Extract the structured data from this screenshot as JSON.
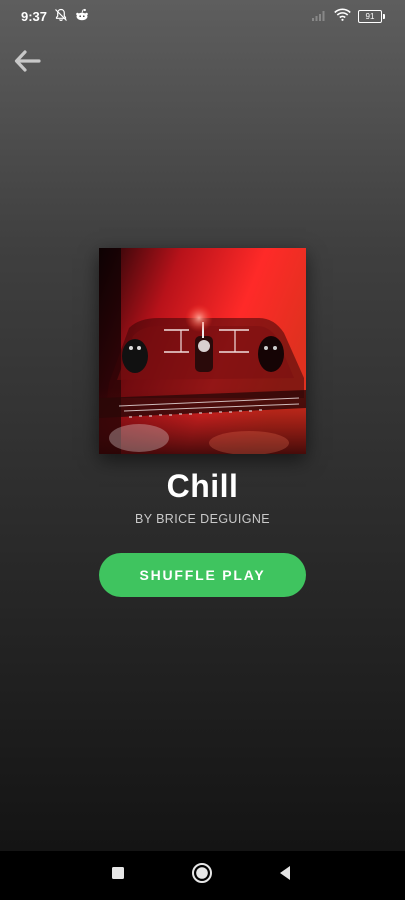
{
  "status_bar": {
    "time": "9:37",
    "battery_level": "91",
    "icons": [
      "notifications-muted-icon",
      "reddit-icon",
      "signal-icon",
      "wifi-icon",
      "battery-icon"
    ]
  },
  "header": {
    "back_icon": "arrow-left-icon"
  },
  "playlist": {
    "title": "Chill",
    "owner": "BY BRICE DEGUIGNE",
    "cover_icon": "cover-art-image"
  },
  "actions": {
    "shuffle_label": "SHUFFLE PLAY"
  },
  "nav_bar": {
    "icons": [
      "recents-square-icon",
      "home-circle-icon",
      "back-triangle-icon"
    ]
  },
  "colors": {
    "accent": "#1db954",
    "background_top": "#5e5e5e",
    "background_bottom": "#141414"
  }
}
